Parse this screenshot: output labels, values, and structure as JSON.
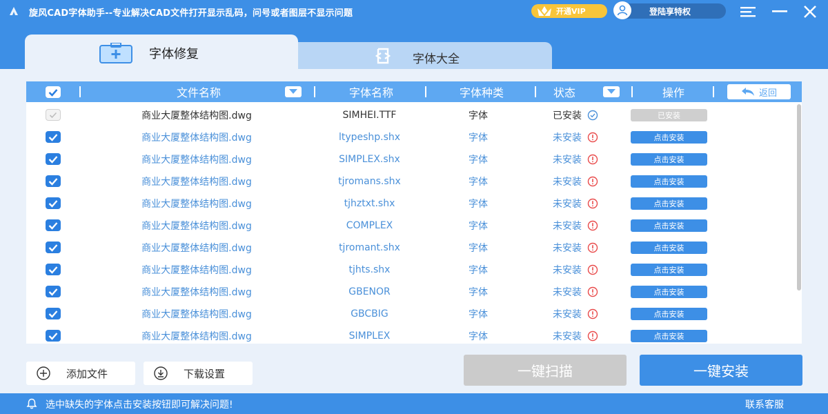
{
  "app": {
    "title": "旋风CAD字体助手--专业解决CAD文件打开显示乱码，问号或者图层不显示问题",
    "vip_label": "开通VIP",
    "login_label": "登陆享特权"
  },
  "tabs": [
    {
      "label": "字体修复",
      "active": true,
      "icon": "first-aid-kit-icon"
    },
    {
      "label": "字体大全",
      "active": false,
      "icon": "font-package-icon"
    }
  ],
  "table": {
    "headers": {
      "file": "文件名称",
      "font": "字体名称",
      "type": "字体种类",
      "status": "状态",
      "operation": "操作",
      "back": "返回"
    },
    "rows": [
      {
        "file": "商业大厦整体结构图.dwg",
        "font": "SIMHEI.TTF",
        "type": "字体",
        "status": "已安装",
        "installed": true,
        "action": "已安装"
      },
      {
        "file": "商业大厦整体结构图.dwg",
        "font": "ltypeshp.shx",
        "type": "字体",
        "status": "未安装",
        "installed": false,
        "action": "点击安装"
      },
      {
        "file": "商业大厦整体结构图.dwg",
        "font": "SIMPLEX.shx",
        "type": "字体",
        "status": "未安装",
        "installed": false,
        "action": "点击安装"
      },
      {
        "file": "商业大厦整体结构图.dwg",
        "font": "tjromans.shx",
        "type": "字体",
        "status": "未安装",
        "installed": false,
        "action": "点击安装"
      },
      {
        "file": "商业大厦整体结构图.dwg",
        "font": "tjhztxt.shx",
        "type": "字体",
        "status": "未安装",
        "installed": false,
        "action": "点击安装"
      },
      {
        "file": "商业大厦整体结构图.dwg",
        "font": "COMPLEX",
        "type": "字体",
        "status": "未安装",
        "installed": false,
        "action": "点击安装"
      },
      {
        "file": "商业大厦整体结构图.dwg",
        "font": "tjromant.shx",
        "type": "字体",
        "status": "未安装",
        "installed": false,
        "action": "点击安装"
      },
      {
        "file": "商业大厦整体结构图.dwg",
        "font": "tjhts.shx",
        "type": "字体",
        "status": "未安装",
        "installed": false,
        "action": "点击安装"
      },
      {
        "file": "商业大厦整体结构图.dwg",
        "font": "GBENOR",
        "type": "字体",
        "status": "未安装",
        "installed": false,
        "action": "点击安装"
      },
      {
        "file": "商业大厦整体结构图.dwg",
        "font": "GBCBIG",
        "type": "字体",
        "status": "未安装",
        "installed": false,
        "action": "点击安装"
      },
      {
        "file": "商业大厦整体结构图.dwg",
        "font": "SIMPLEX",
        "type": "字体",
        "status": "未安装",
        "installed": false,
        "action": "点击安装"
      }
    ]
  },
  "buttons": {
    "add_file": "添加文件",
    "download_settings": "下载设置",
    "scan": "一键扫描",
    "install": "一键安装"
  },
  "statusbar": {
    "tip": "选中缺失的字体点击安装按钮即可解决问题!",
    "contact": "联系客服"
  },
  "colors": {
    "primary": "#3d8fe6",
    "header": "#5ea8f2",
    "vip": "#f8c53a",
    "error": "#e94b4b"
  }
}
